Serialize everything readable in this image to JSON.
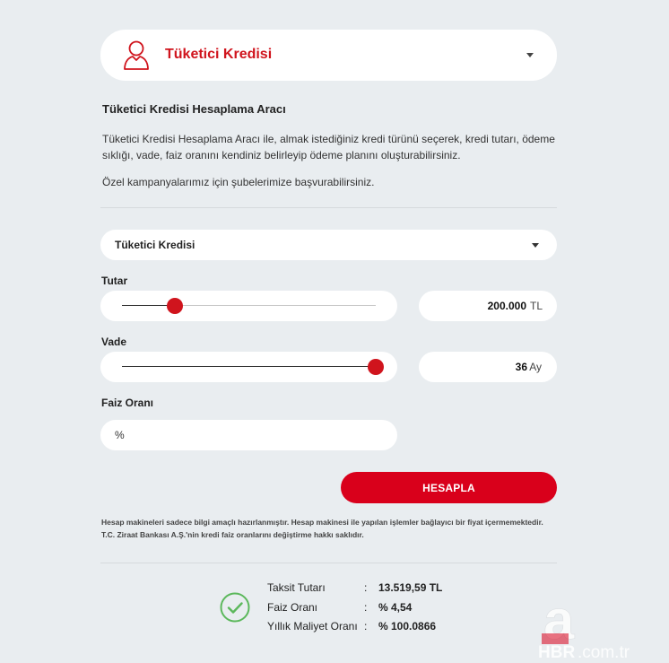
{
  "header": {
    "title": "Tüketici Kredisi",
    "icon": "person-icon",
    "accent_color": "#d0141d"
  },
  "intro": {
    "title": "Tüketici Kredisi Hesaplama Aracı",
    "description": "Tüketici Kredisi Hesaplama Aracı ile, almak istediğiniz kredi türünü seçerek, kredi tutarı, ödeme sıklığı, vade, faiz oranını kendiniz belirleyip ödeme planını oluşturabilirsiniz.",
    "note": "Özel kampanyalarımız için şubelerimize başvurabilirsiniz."
  },
  "form": {
    "loan_type": "Tüketici Kredisi",
    "amount": {
      "label": "Tutar",
      "value": "200.000",
      "unit": "TL",
      "slider_fraction": 0.21
    },
    "term": {
      "label": "Vade",
      "value": "36",
      "unit": "Ay",
      "slider_fraction": 1.0
    },
    "rate": {
      "label": "Faiz Oranı",
      "placeholder": "%"
    },
    "submit_label": "HESAPLA"
  },
  "disclaimer": "Hesap makineleri sadece bilgi amaçlı hazırlanmıştır. Hesap makinesi ile yapılan işlemler bağlayıcı bir fiyat içermemektedir. T.C. Ziraat Bankası A.Ş.'nin kredi faiz oranlarını değiştirme hakkı saklıdır.",
  "results": {
    "icon": "check-circle-icon",
    "colon": ":",
    "rows": [
      {
        "label": "Taksit Tutarı",
        "value": "13.519,59 TL"
      },
      {
        "label": "Faiz Oranı",
        "value": "% 4,54"
      },
      {
        "label": "Yıllık Maliyet Oranı",
        "value": "% 100.0866"
      }
    ]
  },
  "watermark": {
    "logo_text": "a",
    "site_text": "HBR.com.tr"
  }
}
